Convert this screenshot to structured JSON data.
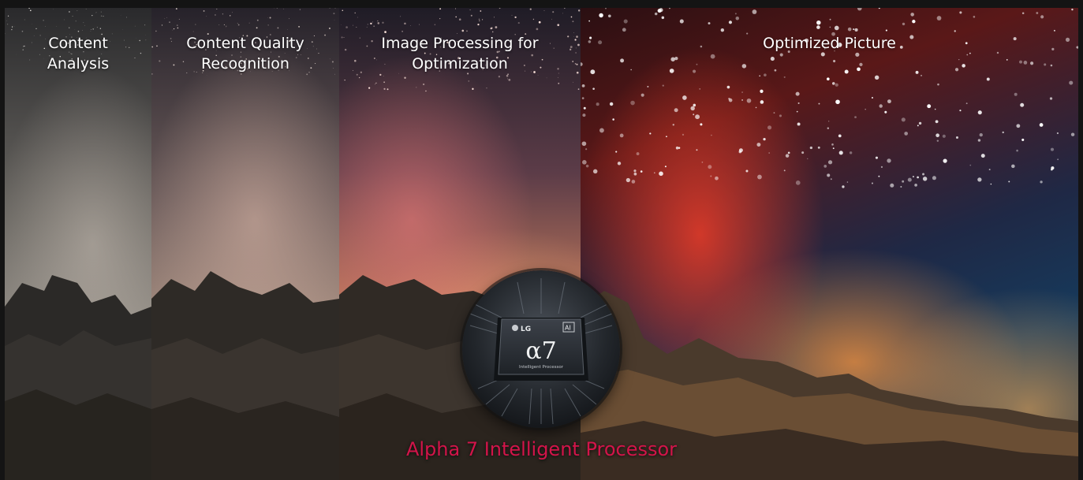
{
  "panels": [
    {
      "id": "content-analysis",
      "label": "Content\nAnalysis"
    },
    {
      "id": "content-quality-recognition",
      "label": "Content Quality\nRecognition"
    },
    {
      "id": "image-processing",
      "label": "Image Processing for\nOptimization"
    },
    {
      "id": "optimized-picture",
      "label": "Optimized Picture"
    }
  ],
  "chip": {
    "brand": "LG",
    "badge": "AI",
    "symbol": "α7",
    "subtitle": "Intelligent Processor"
  },
  "caption": "Alpha 7 Intelligent Processor",
  "colors": {
    "caption": "#d3144a",
    "background": "#141414"
  }
}
